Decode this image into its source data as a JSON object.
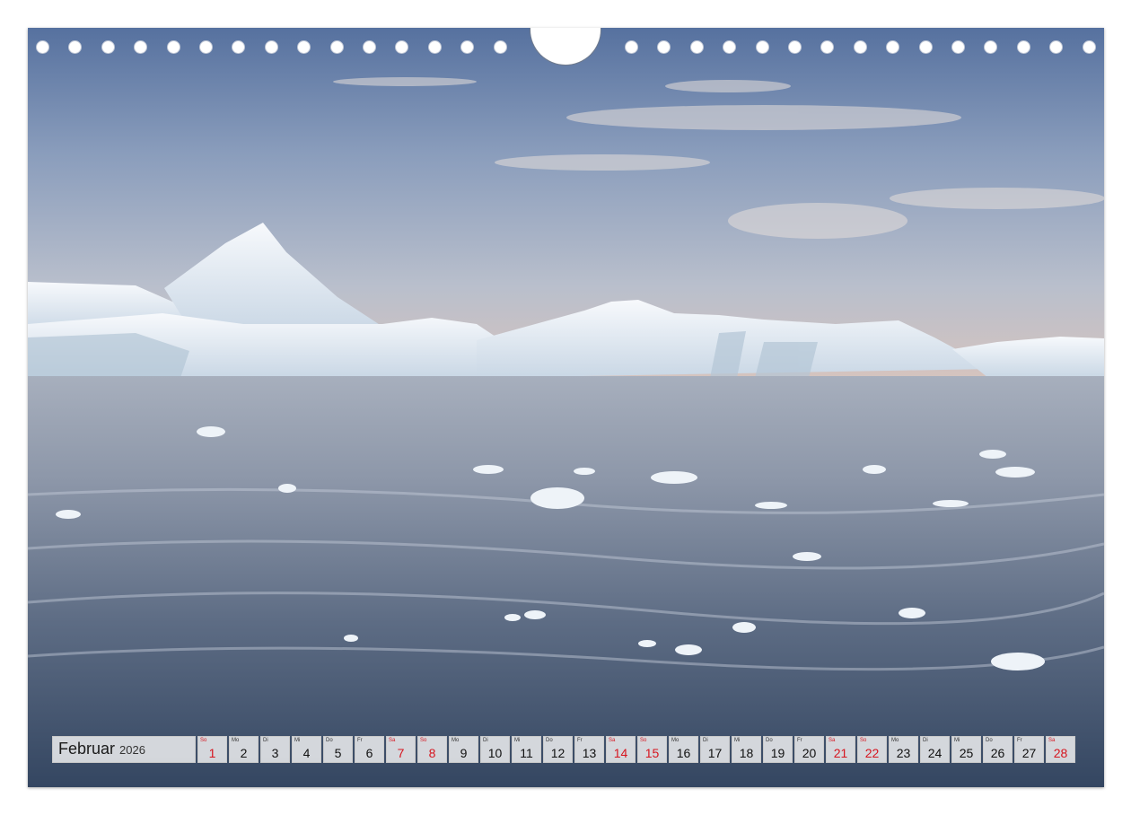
{
  "calendar": {
    "month": "Februar",
    "year": "2026",
    "weekend_color": "#d6141e",
    "days": [
      {
        "wd": "So",
        "num": "1",
        "weekend": true
      },
      {
        "wd": "Mo",
        "num": "2",
        "weekend": false
      },
      {
        "wd": "Di",
        "num": "3",
        "weekend": false
      },
      {
        "wd": "Mi",
        "num": "4",
        "weekend": false
      },
      {
        "wd": "Do",
        "num": "5",
        "weekend": false
      },
      {
        "wd": "Fr",
        "num": "6",
        "weekend": false
      },
      {
        "wd": "Sa",
        "num": "7",
        "weekend": true
      },
      {
        "wd": "So",
        "num": "8",
        "weekend": true
      },
      {
        "wd": "Mo",
        "num": "9",
        "weekend": false
      },
      {
        "wd": "Di",
        "num": "10",
        "weekend": false
      },
      {
        "wd": "Mi",
        "num": "11",
        "weekend": false
      },
      {
        "wd": "Do",
        "num": "12",
        "weekend": false
      },
      {
        "wd": "Fr",
        "num": "13",
        "weekend": false
      },
      {
        "wd": "Sa",
        "num": "14",
        "weekend": true
      },
      {
        "wd": "So",
        "num": "15",
        "weekend": true
      },
      {
        "wd": "Mo",
        "num": "16",
        "weekend": false
      },
      {
        "wd": "Di",
        "num": "17",
        "weekend": false
      },
      {
        "wd": "Mi",
        "num": "18",
        "weekend": false
      },
      {
        "wd": "Do",
        "num": "19",
        "weekend": false
      },
      {
        "wd": "Fr",
        "num": "20",
        "weekend": false
      },
      {
        "wd": "Sa",
        "num": "21",
        "weekend": true
      },
      {
        "wd": "So",
        "num": "22",
        "weekend": true
      },
      {
        "wd": "Mo",
        "num": "23",
        "weekend": false
      },
      {
        "wd": "Di",
        "num": "24",
        "weekend": false
      },
      {
        "wd": "Mi",
        "num": "25",
        "weekend": false
      },
      {
        "wd": "Do",
        "num": "26",
        "weekend": false
      },
      {
        "wd": "Fr",
        "num": "27",
        "weekend": false
      },
      {
        "wd": "Sa",
        "num": "28",
        "weekend": true
      }
    ]
  },
  "photo": {
    "sky_top": "#5f79a8",
    "sky_mid": "#a8b6cc",
    "horizon_glow": "#d9c2b8",
    "ice": "#eef3f8",
    "water_top": "#9aa4b4",
    "water_bottom": "#3b4c66"
  },
  "binding": {
    "hole_count_left": 15,
    "hole_count_right": 15
  }
}
